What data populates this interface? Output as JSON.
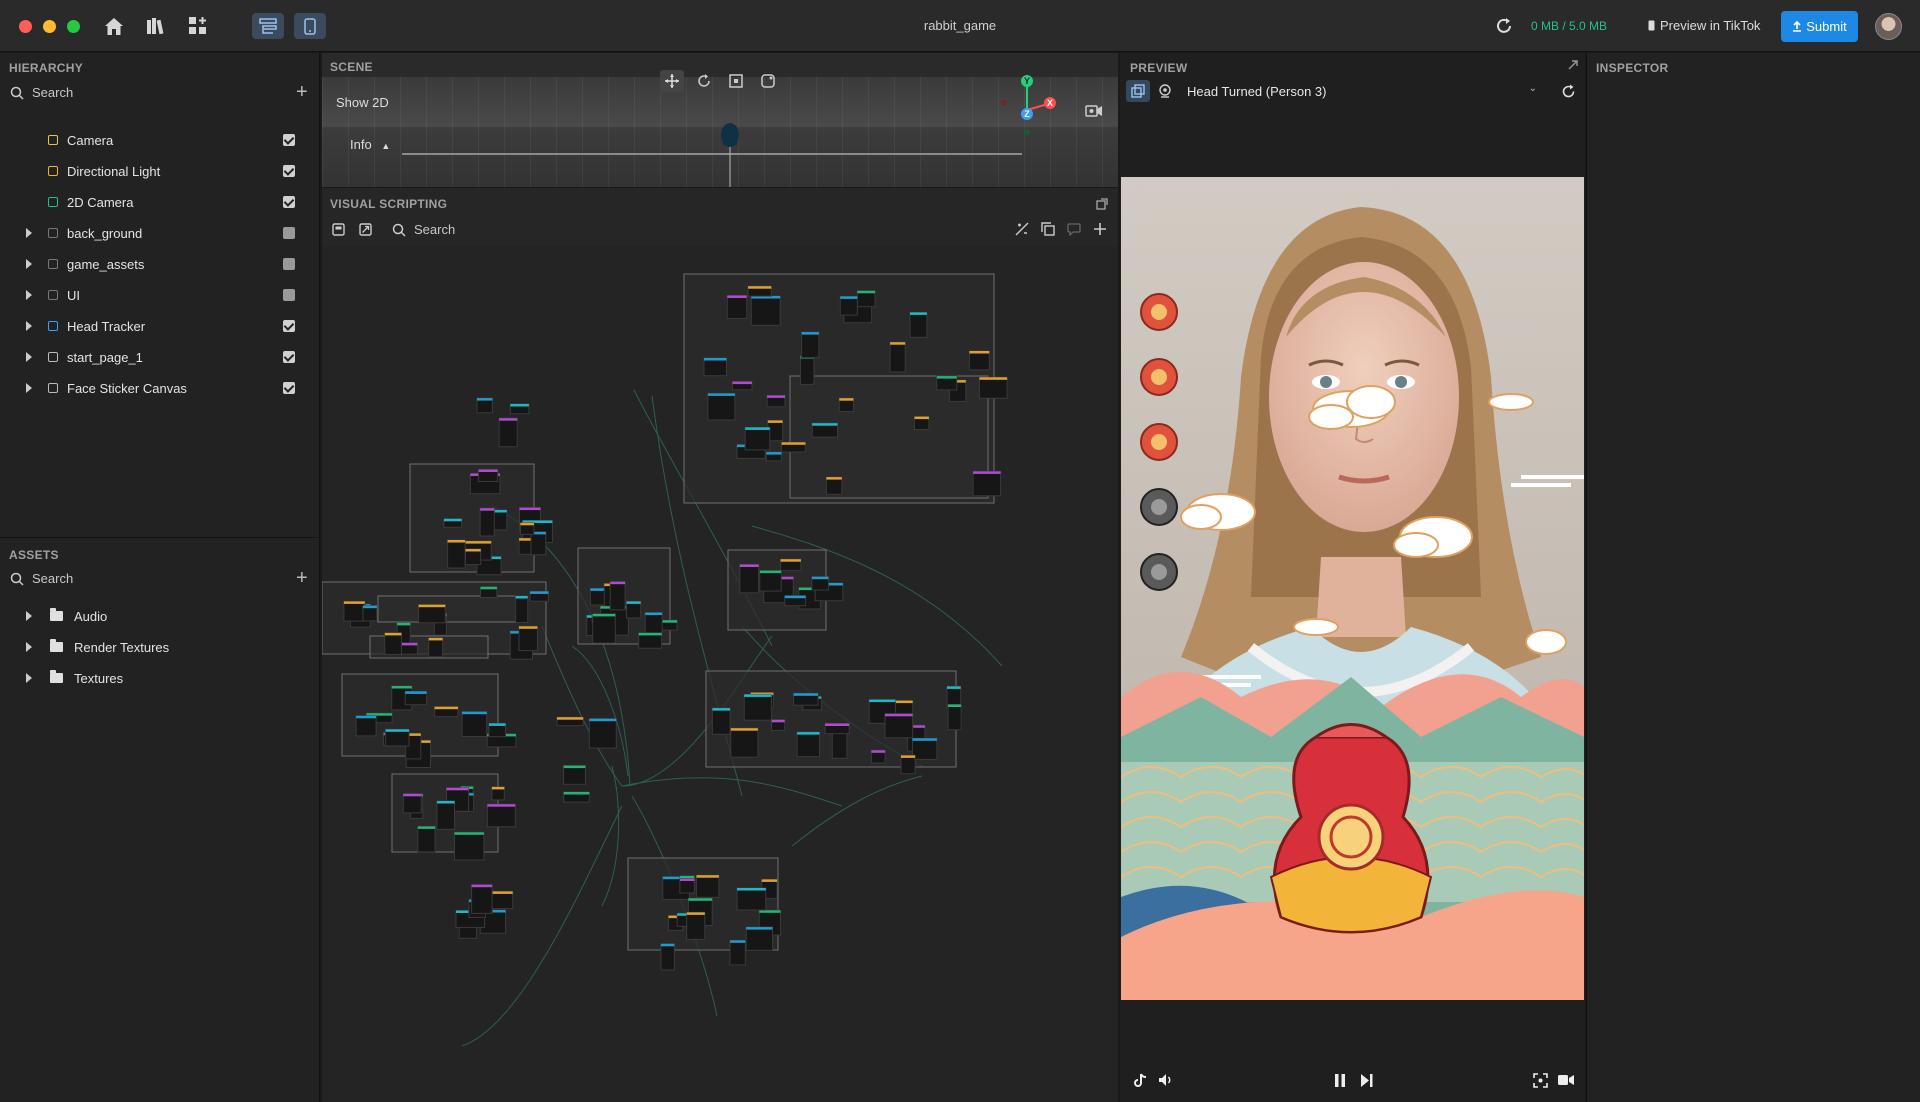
{
  "window": {
    "title": "rabbit_game"
  },
  "toolbar": {
    "home_icon": "home-icon",
    "library_icon": "library-icon",
    "add_widgets_icon": "widgets-icon",
    "storage": "0 MB / 5.0 MB",
    "preview_in_tiktok": "Preview in TikTok",
    "submit": "Submit"
  },
  "hierarchy": {
    "title": "HIERARCHY",
    "search_placeholder": "Search",
    "items": [
      {
        "label": "Camera",
        "icon": "camera-object-icon",
        "color": "#e8c547",
        "expandable": false,
        "visible": true
      },
      {
        "label": "Directional Light",
        "icon": "light-icon",
        "color": "#f0b429",
        "expandable": false,
        "visible": true
      },
      {
        "label": "2D Camera",
        "icon": "video-camera-icon",
        "color": "#22c08a",
        "expandable": false,
        "visible": true
      },
      {
        "label": "back_ground",
        "icon": "object-icon",
        "color": "#777777",
        "expandable": true,
        "visible": false
      },
      {
        "label": "game_assets",
        "icon": "object-icon",
        "color": "#777777",
        "expandable": true,
        "visible": false
      },
      {
        "label": "UI",
        "icon": "object-icon",
        "color": "#777777",
        "expandable": true,
        "visible": false
      },
      {
        "label": "Head Tracker",
        "icon": "head-tracker-icon",
        "color": "#3aa0ff",
        "expandable": true,
        "visible": true
      },
      {
        "label": "start_page_1",
        "icon": "object-icon",
        "color": "#bbbbbb",
        "expandable": true,
        "visible": true
      },
      {
        "label": "Face Sticker Canvas",
        "icon": "object-icon",
        "color": "#bbbbbb",
        "expandable": true,
        "visible": true
      }
    ]
  },
  "assets": {
    "title": "ASSETS",
    "search_placeholder": "Search",
    "folders": [
      "Audio",
      "Render Textures",
      "Textures"
    ]
  },
  "scene": {
    "title": "SCENE",
    "show_2d": "Show 2D",
    "info": "Info",
    "axes": {
      "y": "Y",
      "z": "Z",
      "x": "X"
    }
  },
  "visual_scripting": {
    "title": "VISUAL SCRIPTING",
    "search_placeholder": "Search"
  },
  "preview": {
    "title": "PREVIEW",
    "source": "Head Turned (Person 3)"
  },
  "inspector": {
    "title": "INSPECTOR"
  },
  "colors": {
    "accent": "#1e88e5",
    "storage": "#21c38b"
  }
}
